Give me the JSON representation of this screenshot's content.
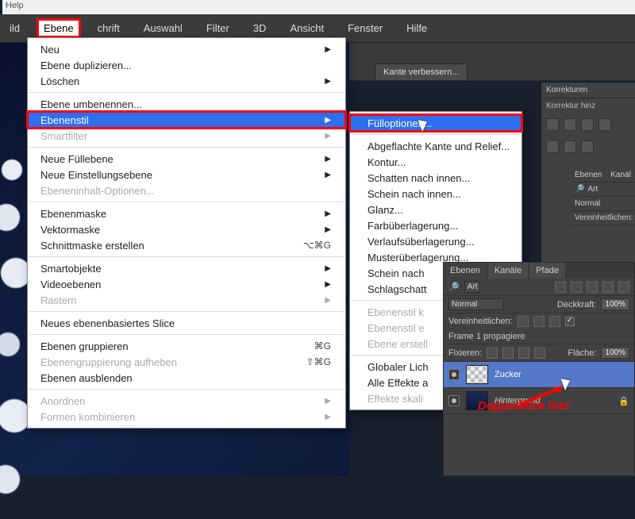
{
  "help_label": "Help",
  "menubar": {
    "items": [
      "ild",
      "Ebene",
      "chrift",
      "Auswahl",
      "Filter",
      "3D",
      "Ansicht",
      "Fenster",
      "Hilfe"
    ],
    "highlighted_index": 1
  },
  "options_bar": {
    "button": "Kante verbessern..."
  },
  "menu": {
    "groups": [
      [
        {
          "label": "Neu",
          "sub": true
        },
        {
          "label": "Ebene duplizieren..."
        },
        {
          "label": "Löschen",
          "sub": true
        }
      ],
      [
        {
          "label": "Ebene umbenennen..."
        },
        {
          "label": "Ebenenstil",
          "sub": true,
          "selected": true
        },
        {
          "label": "Smartfilter",
          "sub": true,
          "disabled": true
        }
      ],
      [
        {
          "label": "Neue Füllebene",
          "sub": true
        },
        {
          "label": "Neue Einstellungsebene",
          "sub": true
        },
        {
          "label": "Ebeneninhalt-Optionen...",
          "disabled": true
        }
      ],
      [
        {
          "label": "Ebenenmaske",
          "sub": true
        },
        {
          "label": "Vektormaske",
          "sub": true
        },
        {
          "label": "Schnittmaske erstellen",
          "shortcut": "⌥⌘G"
        }
      ],
      [
        {
          "label": "Smartobjekte",
          "sub": true
        },
        {
          "label": "Videoebenen",
          "sub": true
        },
        {
          "label": "Rastern",
          "sub": true,
          "disabled": true
        }
      ],
      [
        {
          "label": "Neues ebenenbasiertes Slice"
        }
      ],
      [
        {
          "label": "Ebenen gruppieren",
          "shortcut": "⌘G"
        },
        {
          "label": "Ebenengruppierung aufheben",
          "shortcut": "⇧⌘G",
          "disabled": true
        },
        {
          "label": "Ebenen ausblenden"
        }
      ],
      [
        {
          "label": "Anordnen",
          "sub": true,
          "disabled": true
        },
        {
          "label": "Formen kombinieren",
          "sub": true,
          "disabled": true
        }
      ]
    ]
  },
  "submenu": {
    "groups": [
      [
        {
          "label": "Fülloptionen...",
          "selected": true
        }
      ],
      [
        {
          "label": "Abgeflachte Kante und Relief..."
        },
        {
          "label": "Kontur..."
        },
        {
          "label": "Schatten nach innen..."
        },
        {
          "label": "Schein nach innen..."
        },
        {
          "label": "Glanz..."
        },
        {
          "label": "Farbüberlagerung..."
        },
        {
          "label": "Verlaufsüberlagerung..."
        },
        {
          "label": "Musterüberlagerung..."
        },
        {
          "label": "Schein nach"
        },
        {
          "label": "Schlagschatt"
        }
      ],
      [
        {
          "label": "Ebenenstil k",
          "disabled": true
        },
        {
          "label": "Ebenenstil e",
          "disabled": true
        },
        {
          "label": "Ebene erstell",
          "disabled": true
        }
      ],
      [
        {
          "label": "Globaler Lich"
        },
        {
          "label": "Alle Effekte a"
        },
        {
          "label": "Effekte skali",
          "disabled": true
        }
      ]
    ]
  },
  "right_panels": {
    "korrekturen": {
      "tab": "Korrekturen",
      "text": "Korrektur hinz"
    },
    "ebenen_small": {
      "tabs": [
        "Ebenen",
        "Kanäl"
      ],
      "art": "Art",
      "mode": "Normal",
      "verein": "Vereinheitlichen:"
    }
  },
  "layers_panel": {
    "tabs": [
      "Ebenen",
      "Kanäle",
      "Pfade"
    ],
    "kind_filter": "Art",
    "blend_mode": "Normal",
    "opacity_label": "Deckkraft:",
    "opacity_value": "100%",
    "unify_label": "Vereinheitlichen:",
    "propagate_label": "Frame 1 propagiere",
    "lock_label": "Fixieren:",
    "fill_label": "Fläche:",
    "fill_value": "100%",
    "layers": [
      {
        "name": "Zucker",
        "selected": true
      },
      {
        "name": "Hintergrund",
        "locked": true,
        "italic": true
      }
    ]
  },
  "annotation": "Doppelklick hier"
}
